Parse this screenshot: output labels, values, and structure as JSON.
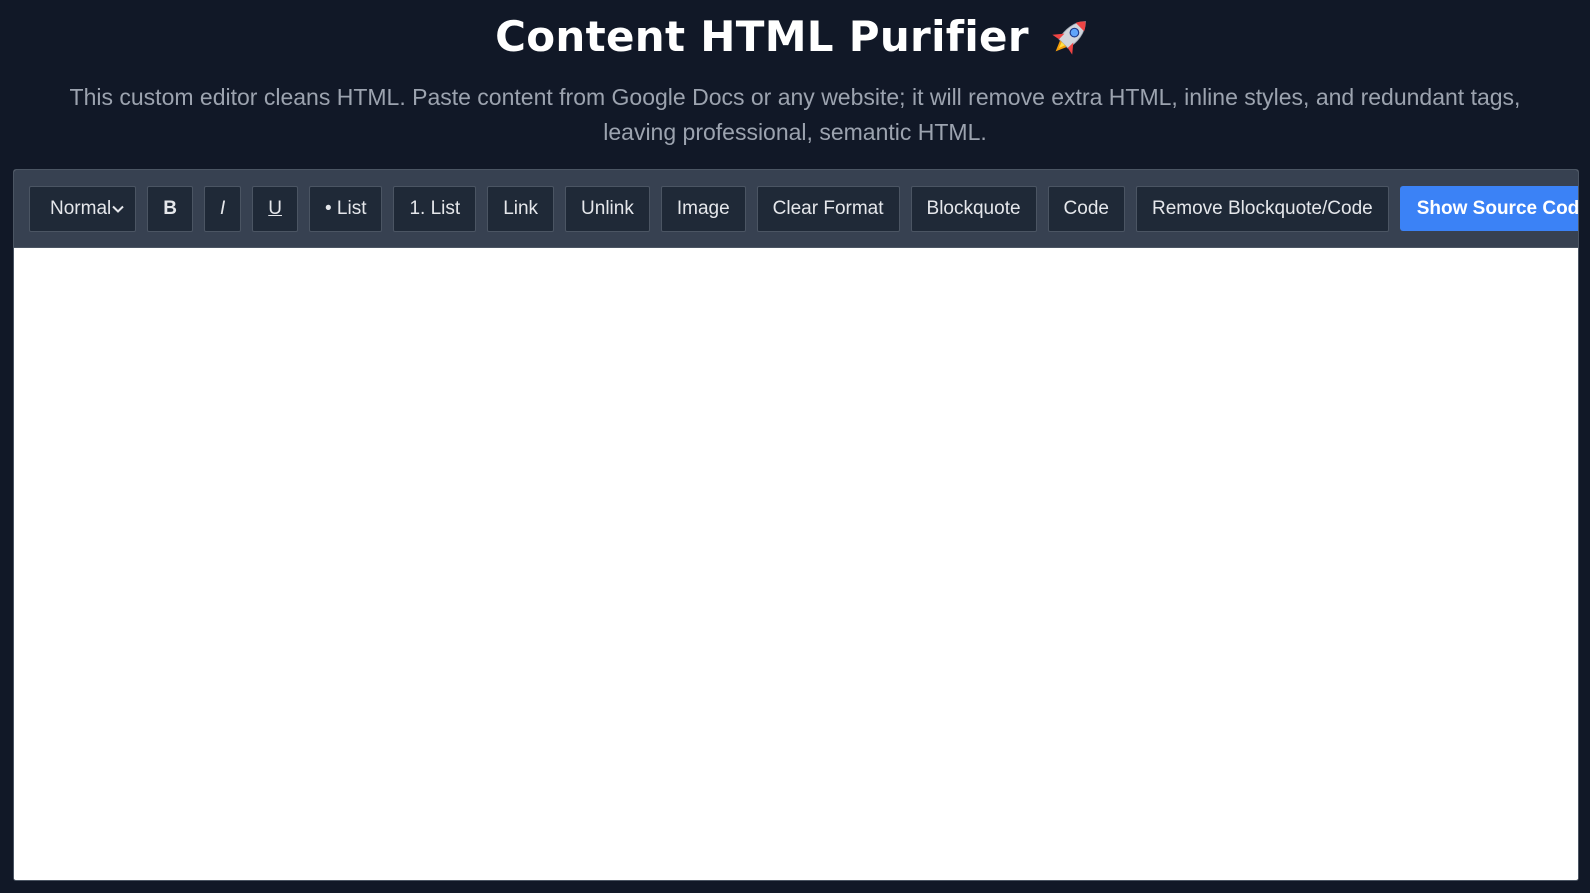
{
  "header": {
    "title": "Content HTML Purifier",
    "title_icon": "rocket-icon",
    "subtitle": "This custom editor cleans HTML. Paste content from Google Docs or any website; it will remove extra HTML, inline styles, and redundant tags, leaving professional, semantic HTML."
  },
  "toolbar": {
    "format_select": {
      "selected": "Normal"
    },
    "buttons": {
      "bold": "B",
      "italic": "I",
      "underline": "U",
      "bullet_list": "• List",
      "numbered_list": "1. List",
      "link": "Link",
      "unlink": "Unlink",
      "image": "Image",
      "clear_format": "Clear Format",
      "blockquote": "Blockquote",
      "code": "Code",
      "remove_blockquote_code": "Remove Blockquote/Code"
    },
    "show_source": "Show Source Code"
  },
  "editor": {
    "content": ""
  },
  "colors": {
    "page_background": "#111827",
    "toolbar_background": "#374151",
    "button_background": "#1f2937",
    "accent": "#3b82f6",
    "subtitle_text": "#9ca3af"
  }
}
